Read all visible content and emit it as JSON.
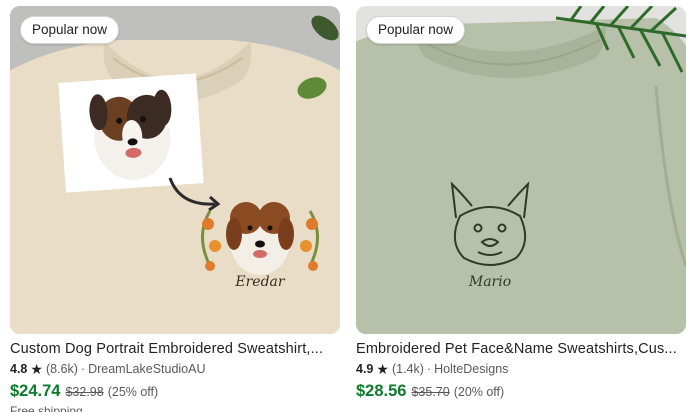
{
  "listings": [
    {
      "badge": "Popular now",
      "title": "Custom Dog Portrait Embroidered Sweatshirt,...",
      "rating": "4.8",
      "review_count": "(8.6k)",
      "separator": "·",
      "shop": "DreamLakeStudioAU",
      "price": "$24.74",
      "original_price": "$32.98",
      "discount": "(25% off)",
      "shipping": "Free shipping",
      "embroidery_name": "Eredar",
      "image_colors": {
        "shirt": "#e8dcc7",
        "background": "#c9c9c9",
        "accent": "#e07b2c"
      }
    },
    {
      "badge": "Popular now",
      "title": "Embroidered Pet Face&Name Sweatshirts,Cus...",
      "rating": "4.9",
      "review_count": "(1.4k)",
      "separator": "·",
      "shop": "HolteDesigns",
      "price": "$28.56",
      "original_price": "$35.70",
      "discount": "(20% off)",
      "embroidery_name": "Mario",
      "image_colors": {
        "shirt": "#b5bfa7",
        "background": "#dcdcdc",
        "accent": "#2f3a26"
      }
    }
  ],
  "icons": {
    "star": "star-icon"
  },
  "colors": {
    "price": "#0e7a2e",
    "muted": "#595959",
    "text": "#222222"
  }
}
